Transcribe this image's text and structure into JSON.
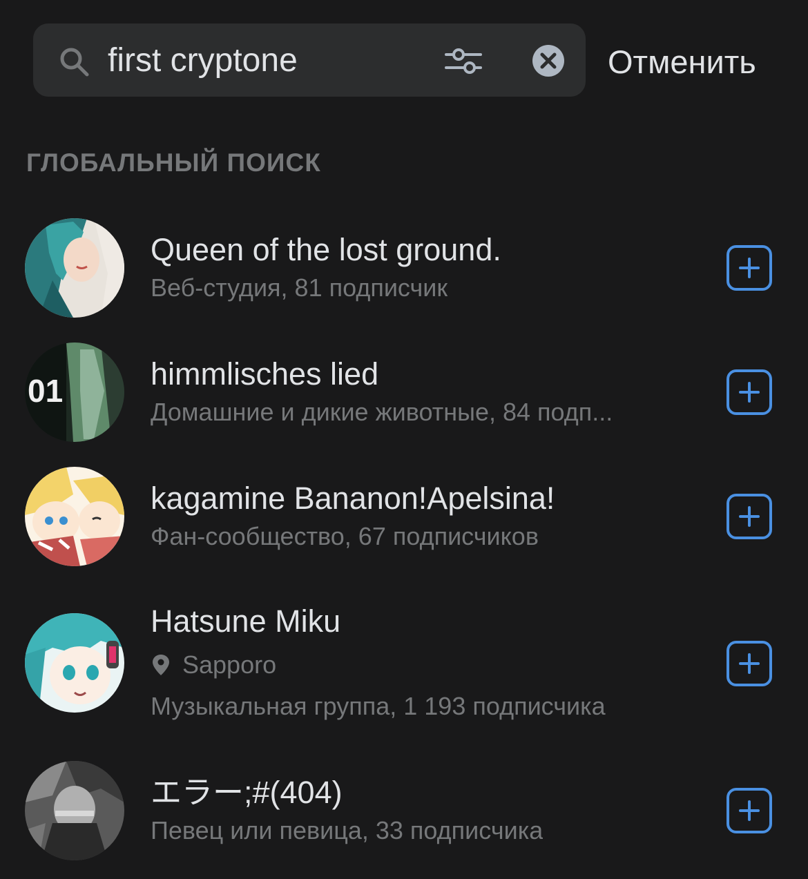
{
  "search": {
    "value": "first cryptone",
    "cancel_label": "Отменить"
  },
  "section": {
    "title": "ГЛОБАЛЬНЫЙ ПОИСК"
  },
  "results": [
    {
      "title": "Queen of the lost ground.",
      "subtitle": "Веб-студия, 81 подписчик"
    },
    {
      "title": "himmlisches lied",
      "subtitle": "Домашние и дикие животные, 84 подп..."
    },
    {
      "title": "kagamine Bananon!Apelsina!",
      "subtitle": "Фан-сообщество, 67 подписчиков"
    },
    {
      "title": "Hatsune Miku",
      "location": "Sapporo",
      "subtitle": "Музыкальная группа, 1 193 подписчика"
    },
    {
      "title": "エラー;#(404)",
      "subtitle": "Певец или певица, 33 подписчика"
    }
  ],
  "colors": {
    "background": "#19191a",
    "search_field": "#2c2d2e",
    "text_primary": "#e1e3e6",
    "text_secondary": "#76787a",
    "accent": "#4a90e2"
  },
  "icons": {
    "search": "search-icon",
    "filter": "filter-icon",
    "clear": "clear-icon",
    "location": "location-pin-icon",
    "add": "add-square-icon"
  }
}
